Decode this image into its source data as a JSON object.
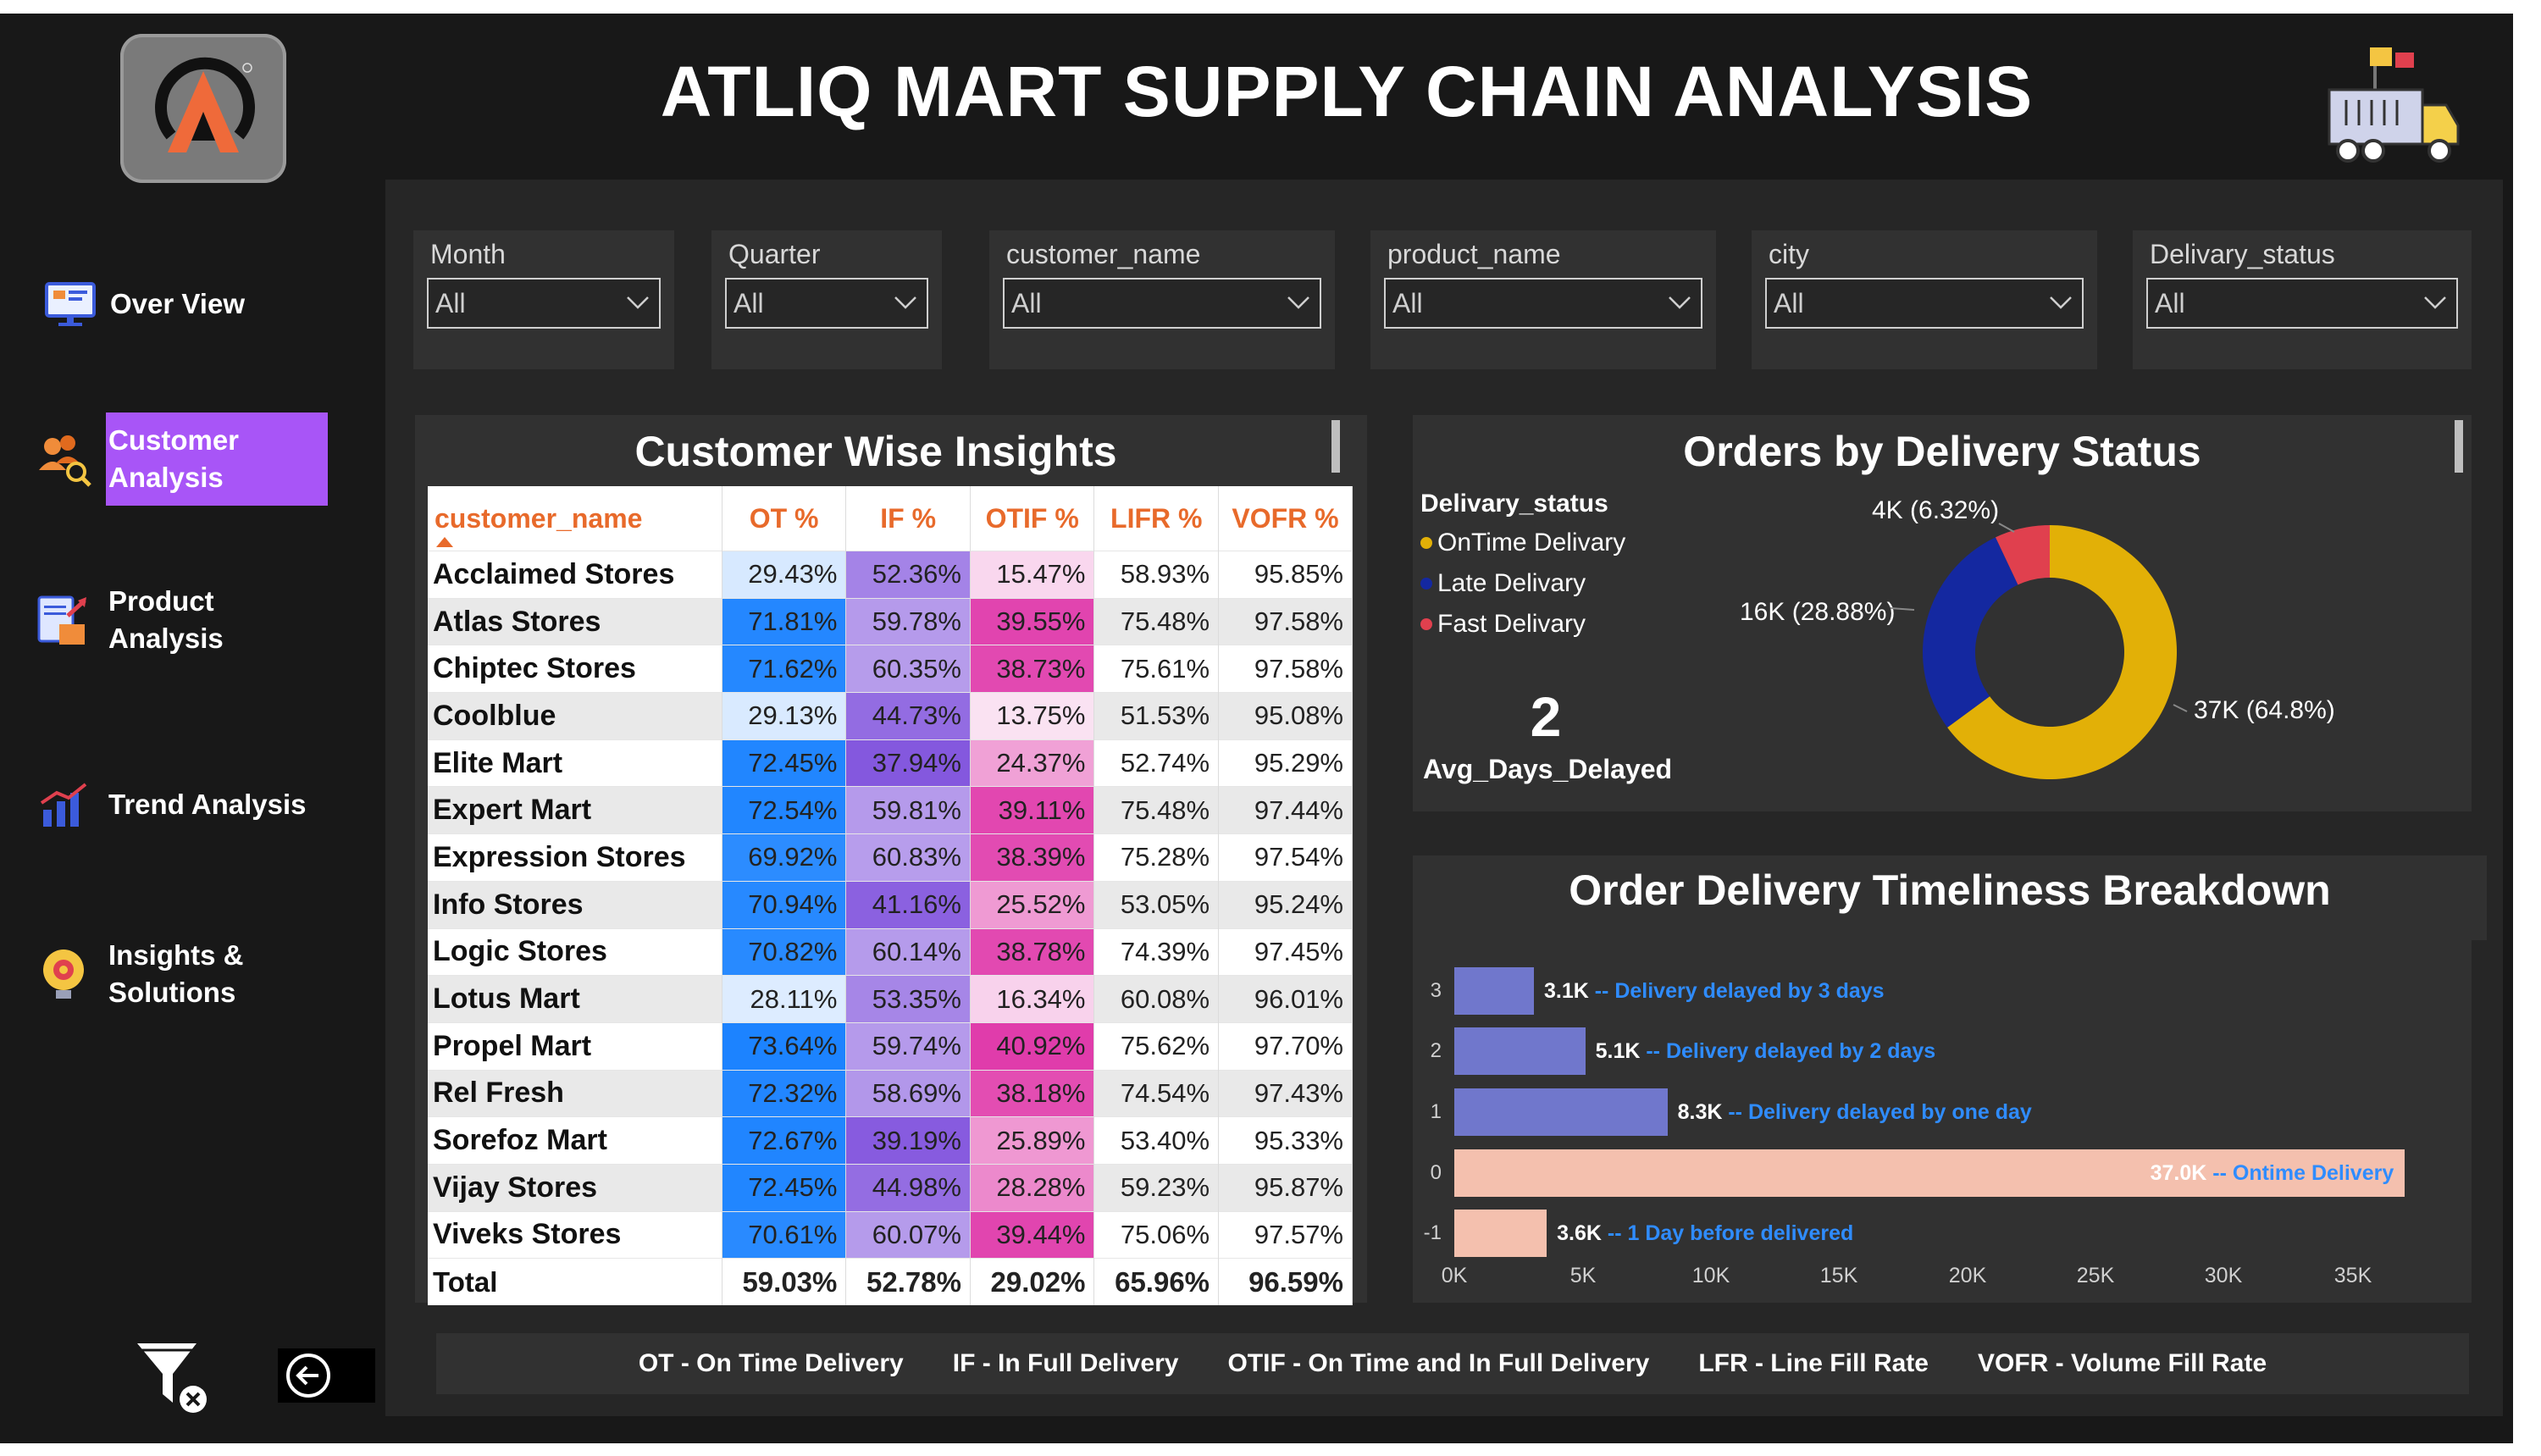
{
  "title": "ATLIQ MART SUPPLY CHAIN ANALYSIS",
  "nav": [
    {
      "label": "Over View",
      "icon": "monitor-dashboard-icon"
    },
    {
      "label": "Customer\nAnalysis",
      "icon": "customers-icon",
      "active": true
    },
    {
      "label": "Product\nAnalysis",
      "icon": "product-clipboard-icon"
    },
    {
      "label": "Trend Analysis",
      "icon": "bar-chart-icon"
    },
    {
      "label": "Insights &\nSolutions",
      "icon": "lightbulb-gear-icon"
    }
  ],
  "slicers": [
    {
      "label": "Month",
      "value": "All"
    },
    {
      "label": "Quarter",
      "value": "All"
    },
    {
      "label": "customer_name",
      "value": "All"
    },
    {
      "label": "product_name",
      "value": "All"
    },
    {
      "label": "city",
      "value": "All"
    },
    {
      "label": "Delivary_status",
      "value": "All"
    }
  ],
  "insights": {
    "title": "Customer Wise Insights",
    "columns": [
      "customer_name",
      "OT %",
      "IF %",
      "OTIF %",
      "LIFR %",
      "VOFR %"
    ],
    "rows": [
      [
        "Acclaimed Stores",
        "29.43%",
        "52.36%",
        "15.47%",
        "58.93%",
        "95.85%"
      ],
      [
        "Atlas Stores",
        "71.81%",
        "59.78%",
        "39.55%",
        "75.48%",
        "97.58%"
      ],
      [
        "Chiptec Stores",
        "71.62%",
        "60.35%",
        "38.73%",
        "75.61%",
        "97.58%"
      ],
      [
        "Coolblue",
        "29.13%",
        "44.73%",
        "13.75%",
        "51.53%",
        "95.08%"
      ],
      [
        "Elite Mart",
        "72.45%",
        "37.94%",
        "24.37%",
        "52.74%",
        "95.29%"
      ],
      [
        "Expert Mart",
        "72.54%",
        "59.81%",
        "39.11%",
        "75.48%",
        "97.44%"
      ],
      [
        "Expression Stores",
        "69.92%",
        "60.83%",
        "38.39%",
        "75.28%",
        "97.54%"
      ],
      [
        "Info Stores",
        "70.94%",
        "41.16%",
        "25.52%",
        "53.05%",
        "95.24%"
      ],
      [
        "Logic Stores",
        "70.82%",
        "60.14%",
        "38.78%",
        "74.39%",
        "97.45%"
      ],
      [
        "Lotus Mart",
        "28.11%",
        "53.35%",
        "16.34%",
        "60.08%",
        "96.01%"
      ],
      [
        "Propel Mart",
        "73.64%",
        "59.74%",
        "40.92%",
        "75.62%",
        "97.70%"
      ],
      [
        "Rel Fresh",
        "72.32%",
        "58.69%",
        "38.18%",
        "74.54%",
        "97.43%"
      ],
      [
        "Sorefoz Mart",
        "72.67%",
        "39.19%",
        "25.89%",
        "53.40%",
        "95.33%"
      ],
      [
        "Vijay Stores",
        "72.45%",
        "44.98%",
        "28.28%",
        "59.23%",
        "95.87%"
      ],
      [
        "Viveks Stores",
        "70.61%",
        "60.07%",
        "39.44%",
        "75.06%",
        "97.57%"
      ]
    ],
    "total": [
      "Total",
      "59.03%",
      "52.78%",
      "29.02%",
      "65.96%",
      "96.59%"
    ],
    "colors": {
      "ot": "#1c83ff",
      "if": "#7c4ddc",
      "otif": "#e03cab"
    }
  },
  "delivery": {
    "title": "Orders by Delivery Status",
    "legend_title": "Delivary_status",
    "slices": [
      {
        "name": "OnTime Delivary",
        "value": 37,
        "label": "37K (64.8%)",
        "color": "#e2b007"
      },
      {
        "name": "Late Delivary",
        "value": 16,
        "label": "16K (28.88%)",
        "color": "#1428a0"
      },
      {
        "name": "Fast Delivary",
        "value": 4,
        "label": "4K (6.32%)",
        "color": "#e0404e"
      }
    ],
    "kpi_value": "2",
    "kpi_label": "Avg_Days_Delayed"
  },
  "chart_data": {
    "type": "bar",
    "title": "Order Delivery Timeliness Breakdown",
    "categories": [
      "3",
      "2",
      "1",
      "0",
      "-1"
    ],
    "values": [
      3.1,
      5.1,
      8.3,
      37.0,
      3.6
    ],
    "unit": "K",
    "value_labels": [
      "3.1K",
      "5.1K",
      "8.3K",
      "37.0K",
      "3.6K"
    ],
    "annotations": [
      "-- Delivery delayed by 3 days",
      "-- Delivery delayed by 2 days",
      "-- Delivery delayed by one day",
      "-- Ontime Delivery",
      "-- 1 Day before delivered"
    ],
    "colors": [
      "#7077cc",
      "#7077cc",
      "#7077cc",
      "#f4c0ae",
      "#f4c0ae"
    ],
    "xticks": [
      "0K",
      "5K",
      "10K",
      "15K",
      "20K",
      "25K",
      "30K",
      "35K"
    ],
    "xlim": [
      0,
      38
    ]
  },
  "abbreviations": [
    "OT - On Time Delivery",
    "IF - In Full Delivery",
    "OTIF - On Time and In Full Delivery",
    "LFR - Line Fill Rate",
    "VOFR - Volume Fill Rate"
  ]
}
